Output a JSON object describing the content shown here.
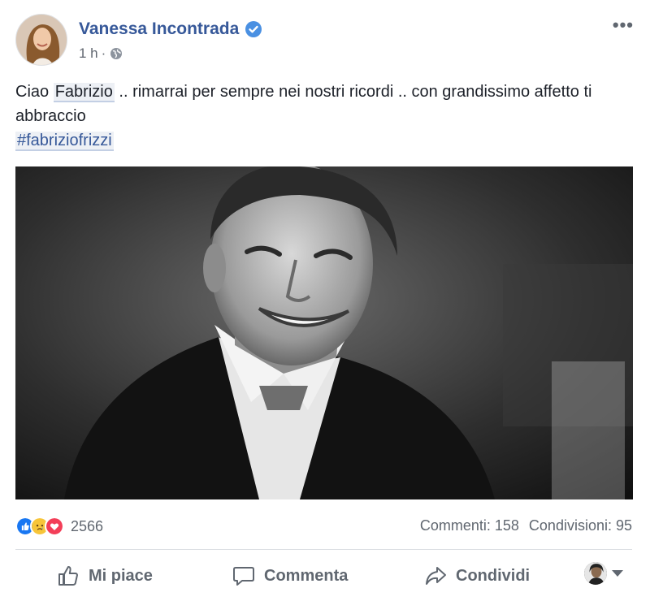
{
  "post": {
    "author": "Vanessa Incontrada",
    "time": "1 h",
    "separator": "·",
    "text_before": "Ciao ",
    "mention": "Fabrizio",
    "text_after": " .. rimarrai per sempre nei nostri ricordi .. con grandissimo affetto ti abbraccio",
    "hashtag": "#fabriziofrizzi"
  },
  "stats": {
    "reaction_count": "2566",
    "comments": "Commenti: 158",
    "shares": "Condivisioni: 95"
  },
  "actions": {
    "like": "Mi piace",
    "comment": "Commenta",
    "share": "Condividi"
  },
  "icons": {
    "verified": "verified-badge-icon",
    "globe": "globe-icon",
    "more": "more-options-icon",
    "like": "thumbs-up-icon",
    "comment": "comment-bubble-icon",
    "share": "share-arrow-icon"
  },
  "colors": {
    "author_link": "#365899",
    "like_blue": "#1877f2",
    "love_red": "#f33e58",
    "sad_yellow": "#f7c53a"
  }
}
